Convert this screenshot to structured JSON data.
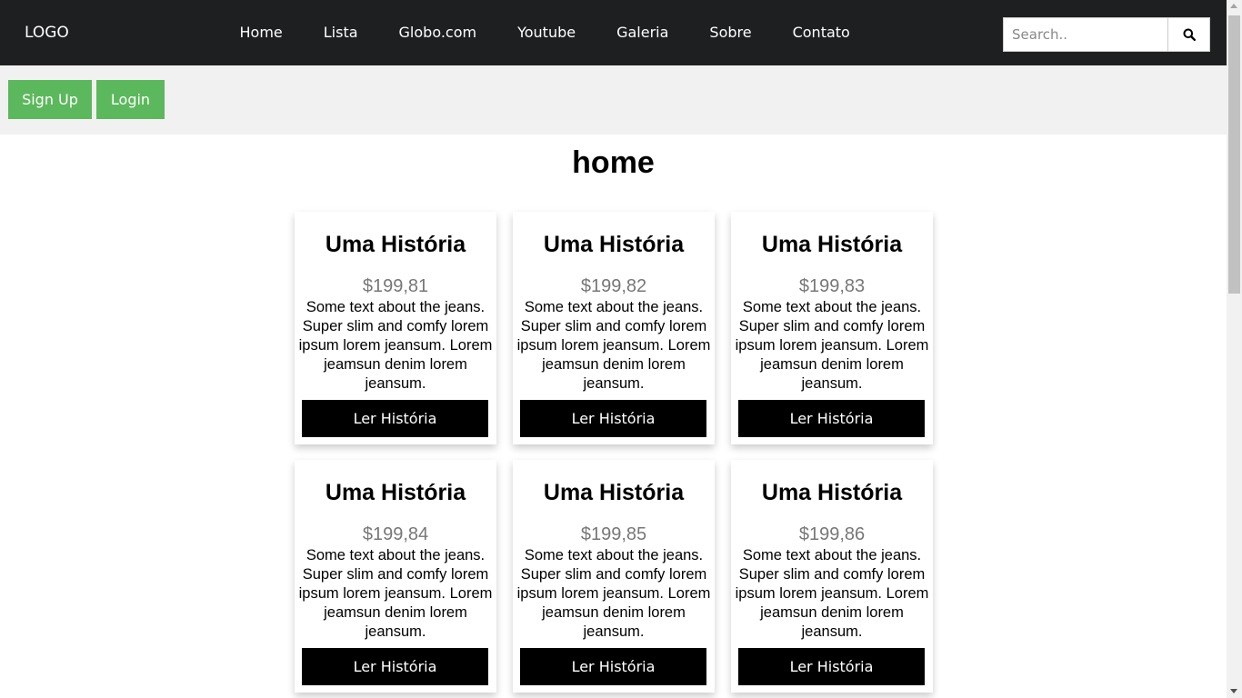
{
  "header": {
    "logo": "LOGO",
    "nav": [
      "Home",
      "Lista",
      "Globo.com",
      "Youtube",
      "Galeria",
      "Sobre",
      "Contato"
    ],
    "search_placeholder": "Search.."
  },
  "auth": {
    "signup_label": "Sign Up",
    "login_label": "Login",
    "button_color": "#5cb85c"
  },
  "main": {
    "title": "home",
    "cards": [
      {
        "title": "Uma História",
        "price": "$199,81",
        "description": "Some text about the jeans. Super slim and comfy lorem ipsum lorem jeansum. Lorem jeamsun denim lorem jeansum.",
        "button": "Ler História"
      },
      {
        "title": "Uma História",
        "price": "$199,82",
        "description": "Some text about the jeans. Super slim and comfy lorem ipsum lorem jeansum. Lorem jeamsun denim lorem jeansum.",
        "button": "Ler História"
      },
      {
        "title": "Uma História",
        "price": "$199,83",
        "description": "Some text about the jeans. Super slim and comfy lorem ipsum lorem jeansum. Lorem jeamsun denim lorem jeansum.",
        "button": "Ler História"
      },
      {
        "title": "Uma História",
        "price": "$199,84",
        "description": "Some text about the jeans. Super slim and comfy lorem ipsum lorem jeansum. Lorem jeamsun denim lorem jeansum.",
        "button": "Ler História"
      },
      {
        "title": "Uma História",
        "price": "$199,85",
        "description": "Some text about the jeans. Super slim and comfy lorem ipsum lorem jeansum. Lorem jeamsun denim lorem jeansum.",
        "button": "Ler História"
      },
      {
        "title": "Uma História",
        "price": "$199,86",
        "description": "Some text about the jeans. Super slim and comfy lorem ipsum lorem jeansum. Lorem jeamsun denim lorem jeansum.",
        "button": "Ler História"
      }
    ]
  },
  "colors": {
    "nav_background": "#1e1f21",
    "auth_bar_background": "#f1f1f1",
    "card_button": "#000000",
    "price_text": "#777777"
  },
  "icons": {
    "search_button": "search-icon"
  }
}
